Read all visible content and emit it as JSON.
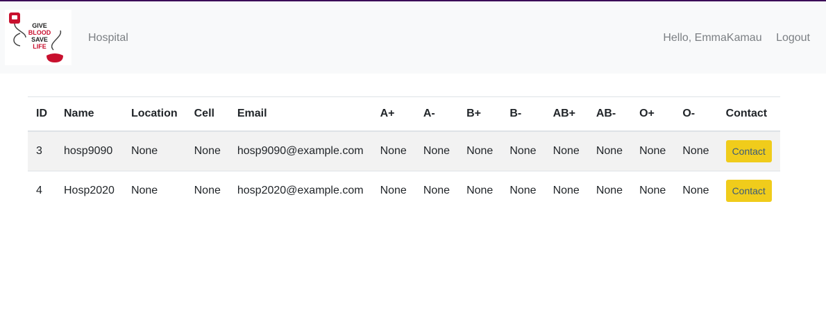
{
  "logo": {
    "lines": [
      "GIVE",
      "BLOOD",
      "SAVE",
      "LIFE"
    ]
  },
  "nav": {
    "brand": "Hospital",
    "greeting": "Hello, EmmaKamau",
    "logout": "Logout"
  },
  "table": {
    "headers": [
      "ID",
      "Name",
      "Location",
      "Cell",
      "Email",
      "A+",
      "A-",
      "B+",
      "B-",
      "AB+",
      "AB-",
      "O+",
      "O-",
      "Contact"
    ],
    "rows": [
      {
        "cells": [
          "3",
          "hosp9090",
          "None",
          "None",
          "hosp9090@example.com",
          "None",
          "None",
          "None",
          "None",
          "None",
          "None",
          "None",
          "None"
        ],
        "button": "Contact"
      },
      {
        "cells": [
          "4",
          "Hosp2020",
          "None",
          "None",
          "hosp2020@example.com",
          "None",
          "None",
          "None",
          "None",
          "None",
          "None",
          "None",
          "None"
        ],
        "button": "Contact"
      }
    ]
  },
  "colors": {
    "accent": "#f0cc1b",
    "topline": "#3b0a57",
    "blood": "#c8102e"
  }
}
